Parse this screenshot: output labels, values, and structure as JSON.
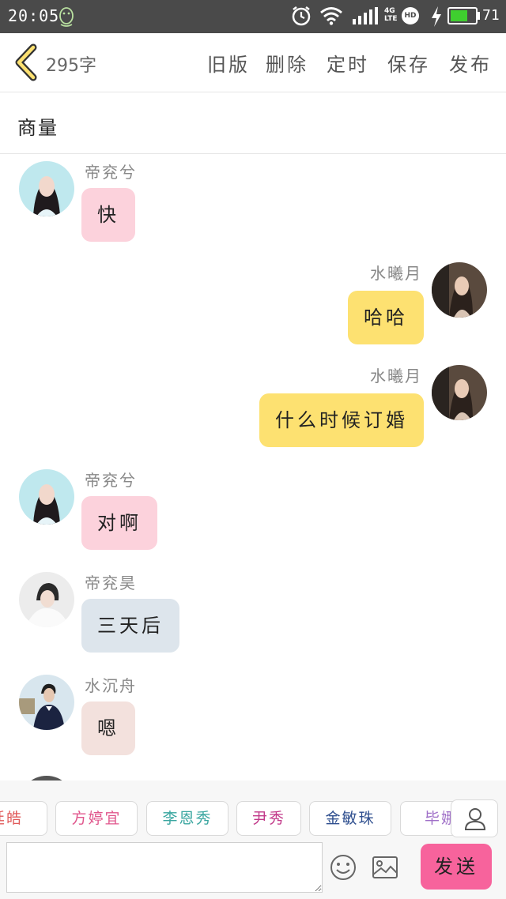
{
  "status_bar": {
    "time": "20:05",
    "network": "4G",
    "network_sub": "LTE",
    "hd": "HD",
    "battery": "71",
    "battery_level": 0.71
  },
  "toolbar": {
    "word_count": "295字",
    "buttons": [
      "旧版",
      "删除",
      "定时",
      "保存",
      "发布"
    ]
  },
  "chat": {
    "title": "商量",
    "messages": [
      {
        "side": "left",
        "name": "帝兖兮",
        "text": "快",
        "bubble_color": "#fcd2dc",
        "avatar": "girl-teal"
      },
      {
        "side": "right",
        "name": "水曦月",
        "text": "哈哈",
        "bubble_color": "#fde171",
        "avatar": "woman-dark"
      },
      {
        "side": "right",
        "name": "水曦月",
        "text": "什么时候订婚",
        "bubble_color": "#fde171",
        "avatar": "woman-dark"
      },
      {
        "side": "left",
        "name": "帝兖兮",
        "text": "对啊",
        "bubble_color": "#fcd2dc",
        "avatar": "girl-teal"
      },
      {
        "side": "left",
        "name": "帝兖昊",
        "text": "三天后",
        "bubble_color": "#dde5ec",
        "avatar": "boy-white"
      },
      {
        "side": "left",
        "name": "水沉舟",
        "text": "嗯",
        "bubble_color": "#f3e1dd",
        "avatar": "man-suit"
      }
    ]
  },
  "characters": [
    {
      "name": "廷皓",
      "color": "#e05a5a"
    },
    {
      "name": "方婷宜",
      "color": "#e0568c"
    },
    {
      "name": "李恩秀",
      "color": "#3aa6a0"
    },
    {
      "name": "尹秀",
      "color": "#c23a8a"
    },
    {
      "name": "金敏珠",
      "color": "#2f4f8f"
    },
    {
      "name": "毕娜",
      "color": "#a070c8"
    }
  ],
  "input": {
    "value": "",
    "placeholder": "",
    "send_label": "发送"
  }
}
